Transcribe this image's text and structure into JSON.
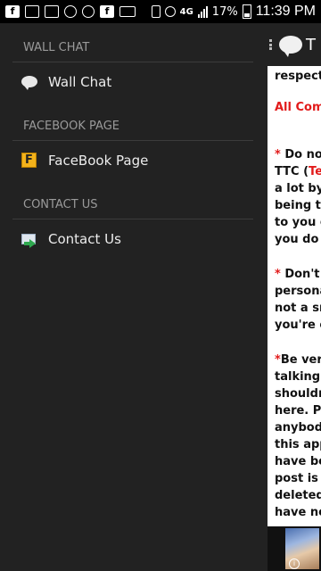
{
  "status_bar": {
    "network": "4G",
    "battery_percent_label": "17%",
    "time": "11:39 PM",
    "left_icons": [
      "facebook-icon",
      "image-icon",
      "camera-icon",
      "shield-icon",
      "usb-icon",
      "facebook-icon",
      "message-icon"
    ]
  },
  "drawer": {
    "sections": [
      {
        "header": "WALL CHAT",
        "item": "Wall Chat",
        "icon": "chat-bubble-icon"
      },
      {
        "header": "FACEBOOK PAGE",
        "item": "FaceBook Page",
        "icon": "facebook-page-icon"
      },
      {
        "header": "CONTACT US",
        "item": "Contact Us",
        "icon": "mail-arrow-icon"
      }
    ]
  },
  "peek": {
    "title_fragment": "T",
    "content": {
      "line1": "respect",
      "heading": "All Com",
      "p1_pre": " Do no\nTTC (",
      "p1_red": "Te",
      "p1_post": "\na lot by\nbeing ta\nto you g\nyou do",
      "p2": " Don't\npersona\nnot a sm\nyou're c",
      "p3": "Be ver\ntalking\nshouldn\nhere. Pl\nanybod\nthis app\nhave be\npost is\ndeleted\nhave no"
    },
    "star": "*"
  },
  "colors": {
    "drawer_bg": "#222222",
    "accent_red": "#e21b1b",
    "header_text": "#9a9a9a"
  }
}
